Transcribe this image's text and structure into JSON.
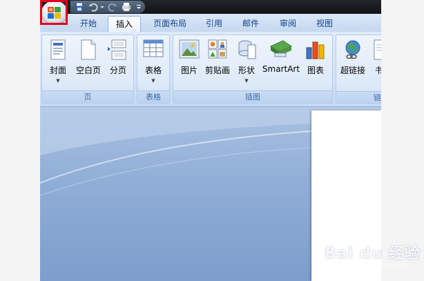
{
  "tabs": [
    {
      "label": "开始",
      "active": false
    },
    {
      "label": "插入",
      "active": true
    },
    {
      "label": "页面布局",
      "active": false
    },
    {
      "label": "引用",
      "active": false
    },
    {
      "label": "邮件",
      "active": false
    },
    {
      "label": "审阅",
      "active": false
    },
    {
      "label": "视图",
      "active": false
    }
  ],
  "quick_access": {
    "icons": [
      "save-icon",
      "undo-icon",
      "redo-icon",
      "print-icon",
      "customize-dropdown-icon"
    ]
  },
  "office_button": {
    "icon": "office-logo-icon",
    "highlighted": true,
    "highlight_color": "#e0001b"
  },
  "ribbon": {
    "groups": {
      "pages": {
        "label": "页",
        "buttons": [
          {
            "label": "封面",
            "icon": "cover-page-icon",
            "has_dropdown": true
          },
          {
            "label": "空白页",
            "icon": "blank-page-icon",
            "has_dropdown": false
          },
          {
            "label": "分页",
            "icon": "page-break-icon",
            "has_dropdown": false
          }
        ]
      },
      "tables": {
        "label": "表格",
        "buttons": [
          {
            "label": "表格",
            "icon": "table-icon",
            "has_dropdown": true
          }
        ]
      },
      "illustrations": {
        "label": "插图",
        "buttons": [
          {
            "label": "图片",
            "icon": "picture-icon",
            "has_dropdown": false
          },
          {
            "label": "剪贴画",
            "icon": "clip-art-icon",
            "has_dropdown": false
          },
          {
            "label": "形状",
            "icon": "shapes-icon",
            "has_dropdown": true
          },
          {
            "label": "SmartArt",
            "icon": "smartart-icon",
            "has_dropdown": false
          },
          {
            "label": "图表",
            "icon": "chart-icon",
            "has_dropdown": false
          }
        ]
      },
      "links": {
        "label": "链",
        "buttons": [
          {
            "label": "超链接",
            "icon": "hyperlink-icon",
            "has_dropdown": false
          },
          {
            "label": "书",
            "icon": "bookmark-icon",
            "has_dropdown": false
          }
        ]
      }
    }
  },
  "watermark": {
    "brand": "Bai du 经验",
    "sub": "jingyan.baidu.com"
  },
  "colors": {
    "tab_text": "#15428b",
    "ribbon_bg": "#dfeaf8",
    "doc_bg": "#8fadd6",
    "highlight": "#e0001b"
  }
}
